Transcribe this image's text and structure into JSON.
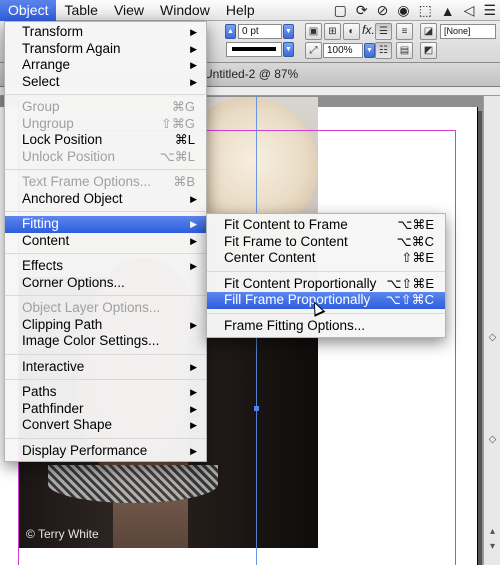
{
  "menubar": {
    "items": [
      "Object",
      "Table",
      "View",
      "Window",
      "Help"
    ],
    "status_icons": [
      "▢",
      "⟳",
      "⊘",
      "◉",
      "⬚",
      "▲",
      "◁",
      "☰"
    ]
  },
  "control_panel": {
    "stroke_weight": "0 pt",
    "zoom_percent": "100%",
    "swatch": "[None]"
  },
  "document": {
    "title": "Untitled-2 @ 87%",
    "copyright": "© Terry White"
  },
  "object_menu": {
    "items": [
      {
        "label": "Transform",
        "shortcut": "",
        "submenu": true,
        "disabled": false
      },
      {
        "label": "Transform Again",
        "shortcut": "",
        "submenu": true,
        "disabled": false
      },
      {
        "label": "Arrange",
        "shortcut": "",
        "submenu": true,
        "disabled": false
      },
      {
        "label": "Select",
        "shortcut": "",
        "submenu": true,
        "disabled": false
      },
      {
        "separator": true
      },
      {
        "label": "Group",
        "shortcut": "⌘G",
        "submenu": false,
        "disabled": true
      },
      {
        "label": "Ungroup",
        "shortcut": "⇧⌘G",
        "submenu": false,
        "disabled": true
      },
      {
        "label": "Lock Position",
        "shortcut": "⌘L",
        "submenu": false,
        "disabled": false
      },
      {
        "label": "Unlock Position",
        "shortcut": "⌥⌘L",
        "submenu": false,
        "disabled": true
      },
      {
        "separator": true
      },
      {
        "label": "Text Frame Options...",
        "shortcut": "⌘B",
        "submenu": false,
        "disabled": true
      },
      {
        "label": "Anchored Object",
        "shortcut": "",
        "submenu": true,
        "disabled": false
      },
      {
        "separator": true
      },
      {
        "label": "Fitting",
        "shortcut": "",
        "submenu": true,
        "disabled": false,
        "highlighted": true
      },
      {
        "label": "Content",
        "shortcut": "",
        "submenu": true,
        "disabled": false
      },
      {
        "separator": true
      },
      {
        "label": "Effects",
        "shortcut": "",
        "submenu": true,
        "disabled": false
      },
      {
        "label": "Corner Options...",
        "shortcut": "",
        "submenu": false,
        "disabled": false
      },
      {
        "separator": true
      },
      {
        "label": "Object Layer Options...",
        "shortcut": "",
        "submenu": false,
        "disabled": true
      },
      {
        "label": "Clipping Path",
        "shortcut": "",
        "submenu": true,
        "disabled": false
      },
      {
        "label": "Image Color Settings...",
        "shortcut": "",
        "submenu": false,
        "disabled": false
      },
      {
        "separator": true
      },
      {
        "label": "Interactive",
        "shortcut": "",
        "submenu": true,
        "disabled": false
      },
      {
        "separator": true
      },
      {
        "label": "Paths",
        "shortcut": "",
        "submenu": true,
        "disabled": false
      },
      {
        "label": "Pathfinder",
        "shortcut": "",
        "submenu": true,
        "disabled": false
      },
      {
        "label": "Convert Shape",
        "shortcut": "",
        "submenu": true,
        "disabled": false
      },
      {
        "separator": true
      },
      {
        "label": "Display Performance",
        "shortcut": "",
        "submenu": true,
        "disabled": false
      }
    ]
  },
  "fitting_menu": {
    "items": [
      {
        "label": "Fit Content to Frame",
        "shortcut": "⌥⌘E"
      },
      {
        "label": "Fit Frame to Content",
        "shortcut": "⌥⌘C"
      },
      {
        "label": "Center Content",
        "shortcut": "⇧⌘E"
      },
      {
        "separator": true
      },
      {
        "label": "Fit Content Proportionally",
        "shortcut": "⌥⇧⌘E"
      },
      {
        "label": "Fill Frame Proportionally",
        "shortcut": "⌥⇧⌘C",
        "highlighted": true
      },
      {
        "separator": true
      },
      {
        "label": "Frame Fitting Options...",
        "shortcut": ""
      }
    ]
  },
  "colors": {
    "highlight": "#2e5ddd",
    "guides": "#d040d0",
    "frame_edge": "#5b8de0"
  }
}
